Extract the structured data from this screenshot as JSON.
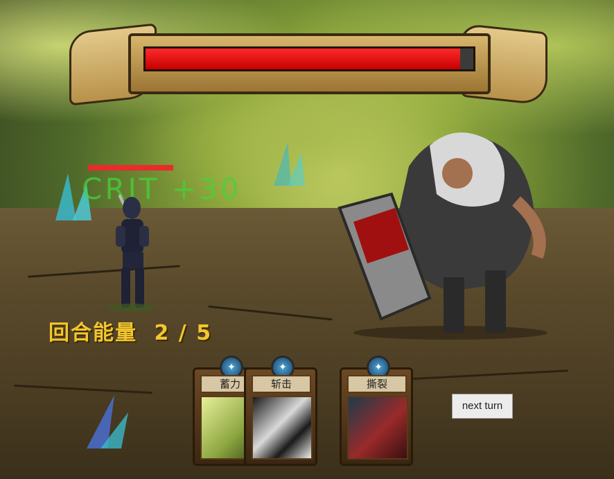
{
  "boss": {
    "hp_fraction": 0.96
  },
  "hero": {
    "hp_fraction": 1.0
  },
  "combat_text": {
    "crit": "CRIT",
    "damage": "+30"
  },
  "energy": {
    "label": "回合能量",
    "current": "2",
    "separator": "/",
    "max": "5"
  },
  "cards": [
    {
      "title": "蓄力",
      "cost_icon": "swirl-icon"
    },
    {
      "title": "斩击",
      "cost_icon": "swirl-icon"
    },
    {
      "title": "撕裂",
      "cost_icon": "swirl-icon"
    }
  ],
  "controls": {
    "next_turn": "next turn"
  },
  "colors": {
    "boss_hp": "#d40000",
    "hero_hp": "#e82c2c",
    "energy_text": "#f2c531",
    "crit_text": "#46d23c"
  }
}
